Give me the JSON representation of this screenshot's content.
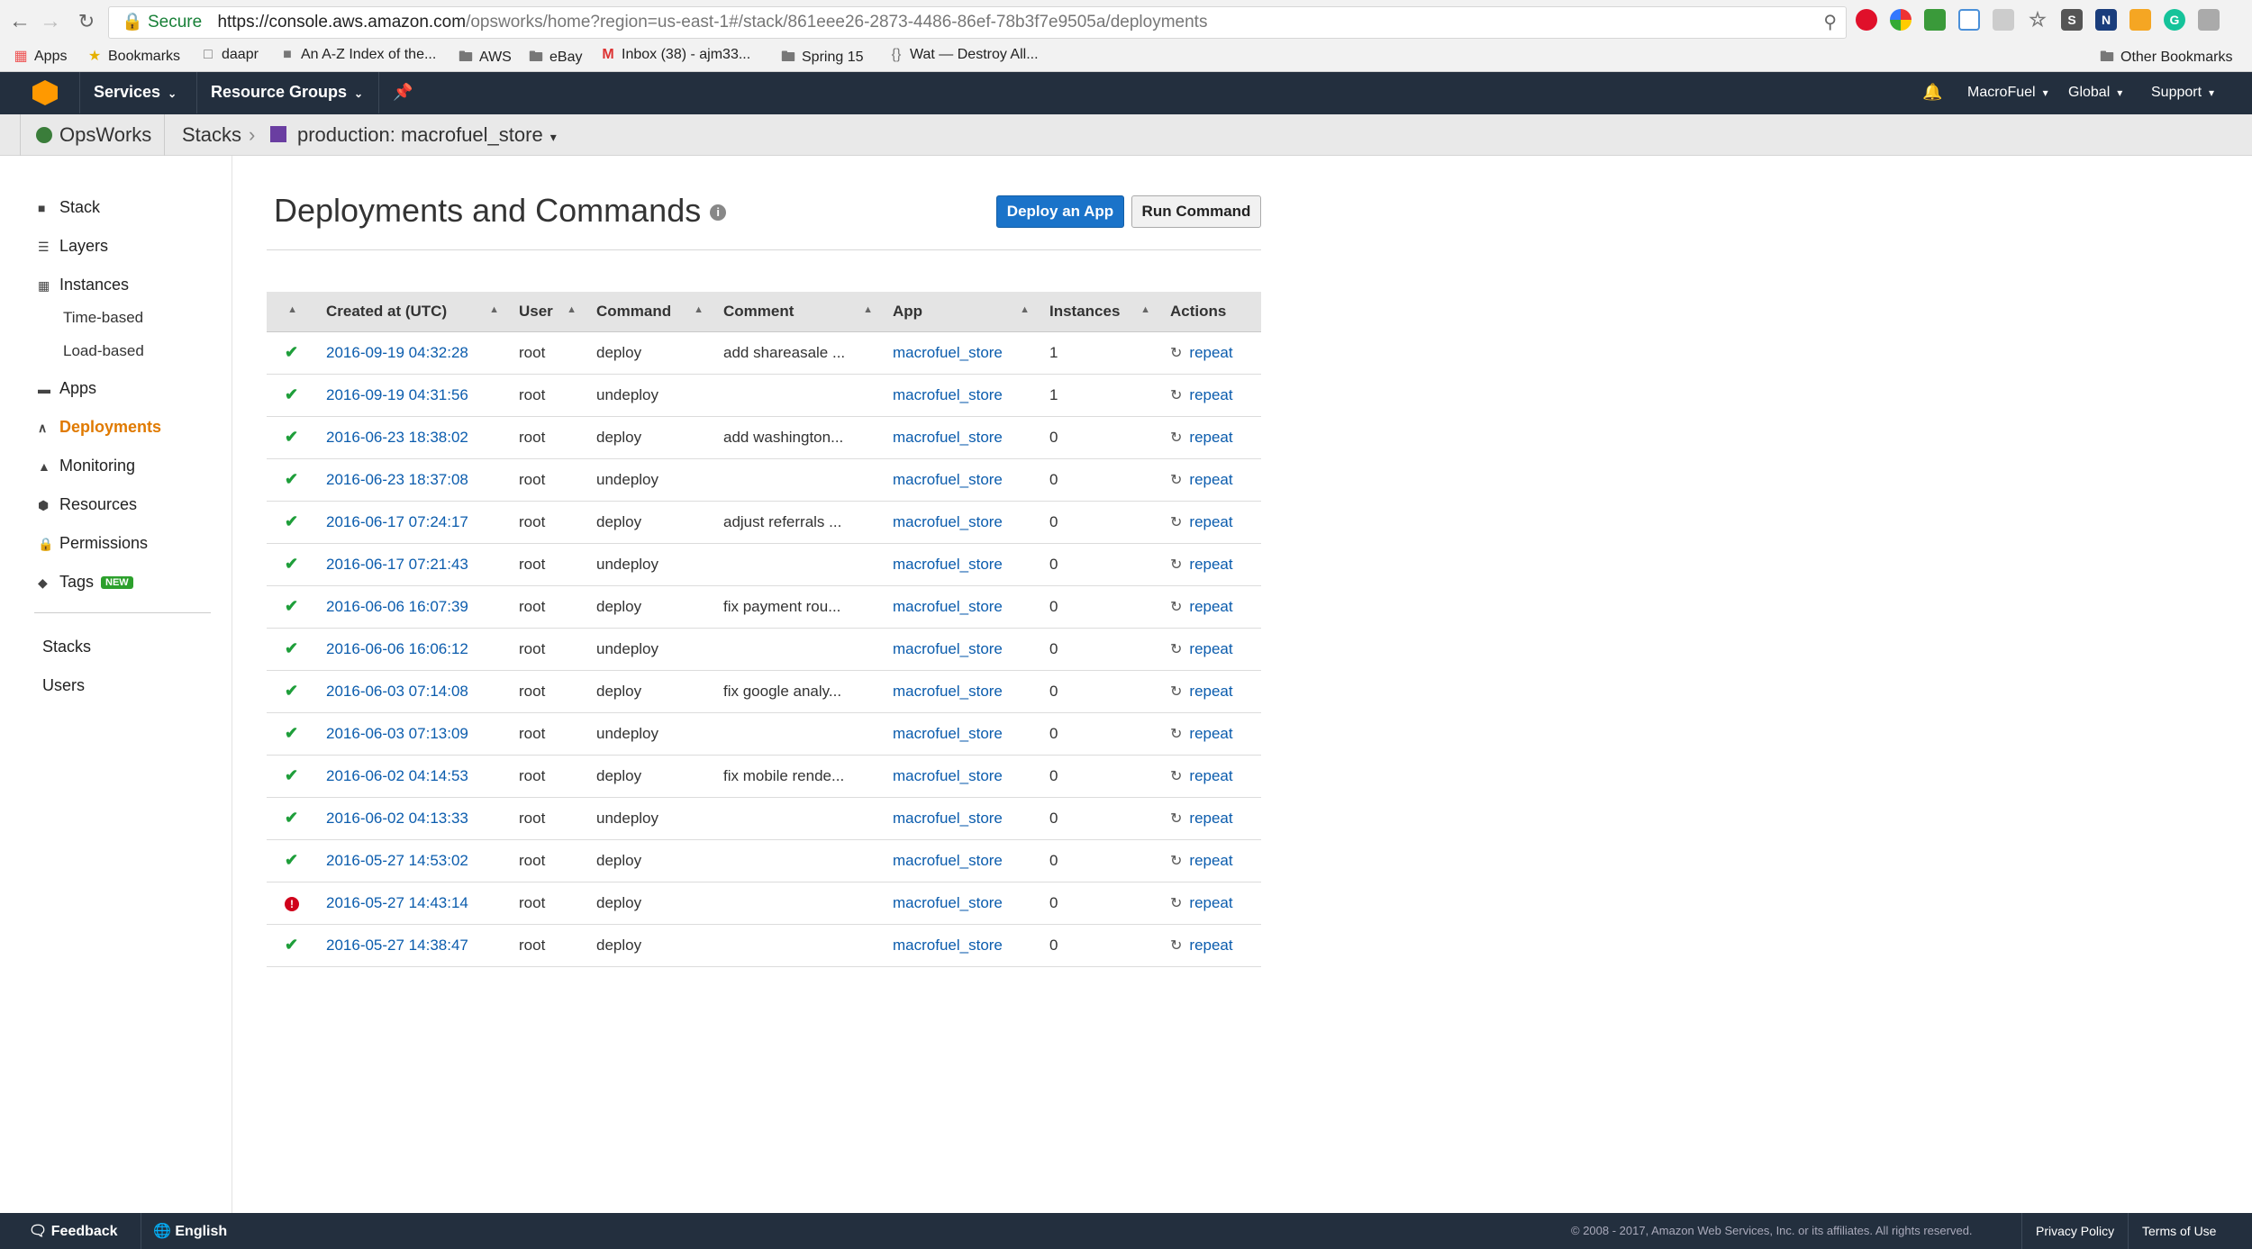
{
  "browser": {
    "secure_label": "Secure",
    "url_host": "https://console.aws.amazon.com",
    "url_path": "/opsworks/home?region=us-east-1#/stack/861eee26-2873-4486-86ef-78b3f7e9505a/deployments",
    "bookmarks": [
      "Apps",
      "Bookmarks",
      "daapr",
      "An A-Z Index of the...",
      "AWS",
      "eBay",
      "Inbox (38) - ajm33...",
      "Spring 15",
      "Wat — Destroy All..."
    ],
    "other_bookmarks": "Other Bookmarks"
  },
  "awsnav": {
    "services": "Services",
    "resource_groups": "Resource Groups",
    "account": "MacroFuel",
    "region": "Global",
    "support": "Support"
  },
  "svcbar": {
    "service": "OpsWorks",
    "stacks": "Stacks",
    "stack_name": "production: macrofuel_store",
    "stack_color": "#6a3ea1"
  },
  "sidebar": {
    "items": [
      "Stack",
      "Layers",
      "Instances",
      "Apps",
      "Deployments",
      "Monitoring",
      "Resources",
      "Permissions",
      "Tags"
    ],
    "instances_sub": [
      "Time-based",
      "Load-based"
    ],
    "new_badge": "NEW",
    "bottom": [
      "Stacks",
      "Users"
    ],
    "active": "Deployments"
  },
  "main": {
    "title": "Deployments and Commands",
    "deploy_button": "Deploy an App",
    "run_button": "Run Command"
  },
  "table": {
    "columns": [
      "Created at (UTC)",
      "User",
      "Command",
      "Comment",
      "App",
      "Instances",
      "Actions"
    ],
    "repeat_label": "repeat",
    "rows": [
      {
        "status": "ok",
        "created": "2016-09-19 04:32:28",
        "user": "root",
        "command": "deploy",
        "comment": "add shareasale ...",
        "app": "macrofuel_store",
        "instances": "1"
      },
      {
        "status": "ok",
        "created": "2016-09-19 04:31:56",
        "user": "root",
        "command": "undeploy",
        "comment": "",
        "app": "macrofuel_store",
        "instances": "1"
      },
      {
        "status": "ok",
        "created": "2016-06-23 18:38:02",
        "user": "root",
        "command": "deploy",
        "comment": "add washington...",
        "app": "macrofuel_store",
        "instances": "0"
      },
      {
        "status": "ok",
        "created": "2016-06-23 18:37:08",
        "user": "root",
        "command": "undeploy",
        "comment": "",
        "app": "macrofuel_store",
        "instances": "0"
      },
      {
        "status": "ok",
        "created": "2016-06-17 07:24:17",
        "user": "root",
        "command": "deploy",
        "comment": "adjust referrals ...",
        "app": "macrofuel_store",
        "instances": "0"
      },
      {
        "status": "ok",
        "created": "2016-06-17 07:21:43",
        "user": "root",
        "command": "undeploy",
        "comment": "",
        "app": "macrofuel_store",
        "instances": "0"
      },
      {
        "status": "ok",
        "created": "2016-06-06 16:07:39",
        "user": "root",
        "command": "deploy",
        "comment": "fix payment rou...",
        "app": "macrofuel_store",
        "instances": "0"
      },
      {
        "status": "ok",
        "created": "2016-06-06 16:06:12",
        "user": "root",
        "command": "undeploy",
        "comment": "",
        "app": "macrofuel_store",
        "instances": "0"
      },
      {
        "status": "ok",
        "created": "2016-06-03 07:14:08",
        "user": "root",
        "command": "deploy",
        "comment": "fix google analy...",
        "app": "macrofuel_store",
        "instances": "0"
      },
      {
        "status": "ok",
        "created": "2016-06-03 07:13:09",
        "user": "root",
        "command": "undeploy",
        "comment": "",
        "app": "macrofuel_store",
        "instances": "0"
      },
      {
        "status": "ok",
        "created": "2016-06-02 04:14:53",
        "user": "root",
        "command": "deploy",
        "comment": "fix mobile rende...",
        "app": "macrofuel_store",
        "instances": "0"
      },
      {
        "status": "ok",
        "created": "2016-06-02 04:13:33",
        "user": "root",
        "command": "undeploy",
        "comment": "",
        "app": "macrofuel_store",
        "instances": "0"
      },
      {
        "status": "ok",
        "created": "2016-05-27 14:53:02",
        "user": "root",
        "command": "deploy",
        "comment": "",
        "app": "macrofuel_store",
        "instances": "0"
      },
      {
        "status": "error",
        "created": "2016-05-27 14:43:14",
        "user": "root",
        "command": "deploy",
        "comment": "",
        "app": "macrofuel_store",
        "instances": "0"
      },
      {
        "status": "ok",
        "created": "2016-05-27 14:38:47",
        "user": "root",
        "command": "deploy",
        "comment": "",
        "app": "macrofuel_store",
        "instances": "0"
      }
    ]
  },
  "footer": {
    "feedback": "Feedback",
    "language": "English",
    "copyright": "© 2008 - 2017, Amazon Web Services, Inc. or its affiliates. All rights reserved.",
    "privacy": "Privacy Policy",
    "terms": "Terms of Use"
  },
  "colors": {
    "aws_nav_bg": "#232f3e",
    "accent_orange": "#e07a00",
    "primary_button": "#1a73c9",
    "link": "#0b5cad",
    "success": "#1e9e3a",
    "error": "#d0021b"
  },
  "icons": [
    "back-icon",
    "forward-icon",
    "reload-icon",
    "lock-icon",
    "search-icon",
    "star-icon",
    "bell-icon",
    "pin-icon",
    "info-icon",
    "check-icon",
    "error-icon",
    "repeat-icon",
    "chat-icon",
    "globe-icon"
  ]
}
